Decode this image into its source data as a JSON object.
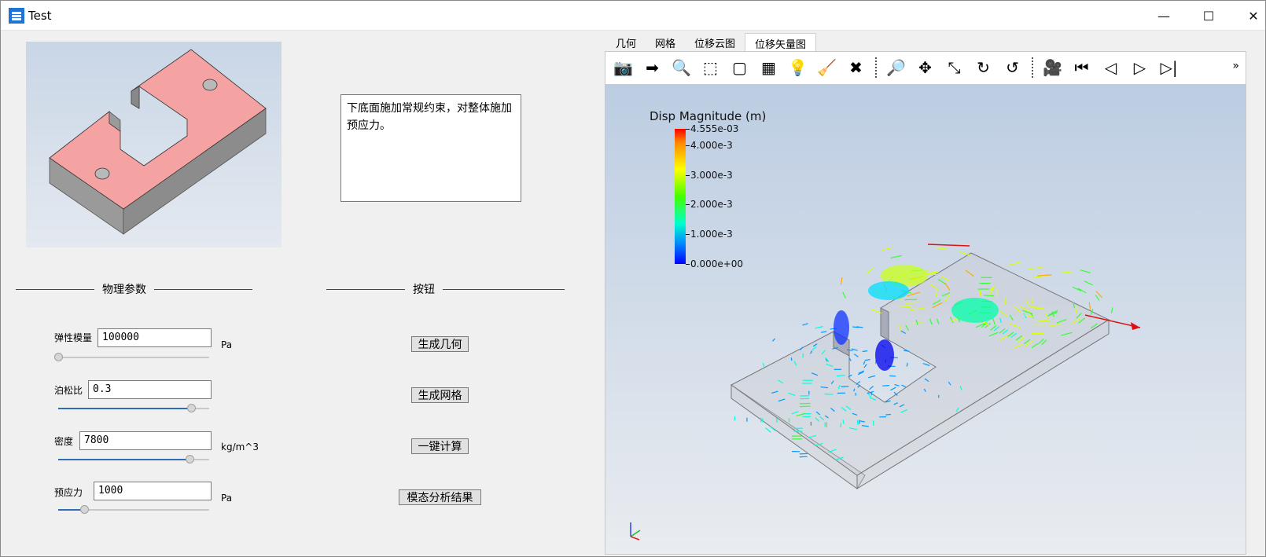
{
  "window": {
    "title": "Test",
    "minimize": "—",
    "maximize": "☐",
    "close": "✕"
  },
  "note": "下底面施加常规约束，对整体施加预应力。",
  "physics_group": {
    "title": "物理参数"
  },
  "buttons_group": {
    "title": "按钮"
  },
  "params": [
    {
      "label": "弹性模量",
      "value": "100000",
      "unit": "Pa",
      "slider": 0.0
    },
    {
      "label": "泊松比",
      "value": "0.3",
      "unit": "",
      "slider": 0.88
    },
    {
      "label": "密度",
      "value": "7800",
      "unit": "kg/m^3",
      "slider": 0.87
    },
    {
      "label": "预应力",
      "value": "1000",
      "unit": "Pa",
      "slider": 0.17
    }
  ],
  "actions": {
    "geometry": "生成几何",
    "mesh": "生成网格",
    "compute": "一键计算",
    "modal": "模态分析结果"
  },
  "tabs": [
    "几何",
    "网格",
    "位移云图",
    "位移矢量图"
  ],
  "active_tab": "位移矢量图",
  "toolbar_icons": [
    "camera-icon",
    "export-icon",
    "probe-icon",
    "fit-box-icon",
    "box-icon",
    "display-mode-icon",
    "lighting-icon",
    "broom-icon",
    "ruler-clear-icon",
    "zoom-box-icon",
    "pan-icon",
    "axes-icon",
    "rotate-cw-icon",
    "rotate-ccw-icon",
    "record-video-icon",
    "first-frame-icon",
    "step-back-icon",
    "play-icon",
    "step-forward-icon"
  ],
  "toolbar_more": "»",
  "legend": {
    "title": "Disp Magnitude (m)",
    "ticks": [
      "4.555e-03",
      "4.000e-3",
      "3.000e-3",
      "2.000e-3",
      "1.000e-3",
      "0.000e+00"
    ],
    "tick_values": [
      4.555,
      4.0,
      3.0,
      2.0,
      1.0,
      0.0
    ]
  }
}
